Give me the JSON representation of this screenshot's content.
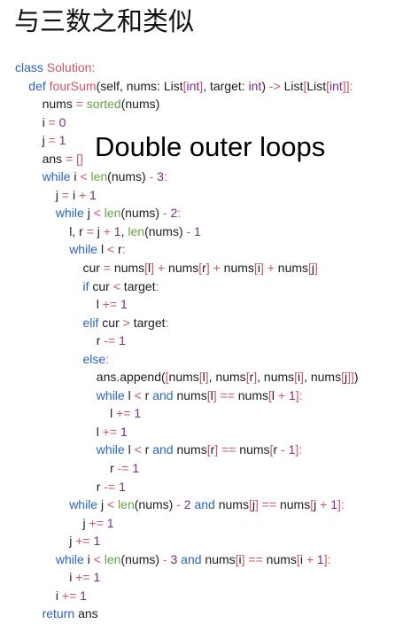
{
  "page": {
    "title": "与三数之和类似",
    "overlay_note": "Double outer loops"
  },
  "colors": {
    "keyword": "#2a64c1",
    "class_name": "#d25564",
    "function_name": "#d25564",
    "builtin": "#66a341",
    "type": "#7c2a8a",
    "number": "#7c2a8a",
    "operator": "#d25564",
    "plain": "#1c1c1c"
  },
  "code": {
    "lines": [
      {
        "indent": 0,
        "tokens": [
          [
            "kw",
            "class "
          ],
          [
            "cls",
            "Solution"
          ],
          [
            "op",
            ":"
          ]
        ]
      },
      {
        "indent": 1,
        "tokens": [
          [
            "kw",
            "def "
          ],
          [
            "fn",
            "fourSum"
          ],
          [
            "pl",
            "(self, nums: List"
          ],
          [
            "op",
            "["
          ],
          [
            "ty",
            "int"
          ],
          [
            "op",
            "]"
          ],
          [
            "pl",
            ", target: "
          ],
          [
            "ty",
            "int"
          ],
          [
            "pl",
            ") "
          ],
          [
            "op",
            "->"
          ],
          [
            "pl",
            " List"
          ],
          [
            "op",
            "["
          ],
          [
            "pl",
            "List"
          ],
          [
            "op",
            "["
          ],
          [
            "ty",
            "int"
          ],
          [
            "op",
            "]]"
          ],
          [
            "op",
            ":"
          ]
        ]
      },
      {
        "indent": 2,
        "tokens": [
          [
            "pl",
            "nums "
          ],
          [
            "op",
            "="
          ],
          [
            "pl",
            " "
          ],
          [
            "bi",
            "sorted"
          ],
          [
            "pl",
            "(nums)"
          ]
        ]
      },
      {
        "indent": 2,
        "tokens": [
          [
            "pl",
            "i "
          ],
          [
            "op",
            "="
          ],
          [
            "pl",
            " "
          ],
          [
            "num",
            "0"
          ]
        ]
      },
      {
        "indent": 2,
        "tokens": [
          [
            "pl",
            "j "
          ],
          [
            "op",
            "="
          ],
          [
            "pl",
            " "
          ],
          [
            "num",
            "1"
          ]
        ]
      },
      {
        "indent": 2,
        "tokens": [
          [
            "pl",
            "ans "
          ],
          [
            "op",
            "="
          ],
          [
            "pl",
            " "
          ],
          [
            "op",
            "[]"
          ]
        ]
      },
      {
        "indent": 2,
        "tokens": [
          [
            "kw",
            "while "
          ],
          [
            "pl",
            "i "
          ],
          [
            "op",
            "<"
          ],
          [
            "pl",
            " "
          ],
          [
            "bi",
            "len"
          ],
          [
            "pl",
            "(nums) "
          ],
          [
            "op",
            "-"
          ],
          [
            "pl",
            " "
          ],
          [
            "num",
            "3"
          ],
          [
            "op",
            ":"
          ]
        ]
      },
      {
        "indent": 3,
        "tokens": [
          [
            "pl",
            "j "
          ],
          [
            "op",
            "="
          ],
          [
            "pl",
            " i "
          ],
          [
            "op",
            "+"
          ],
          [
            "pl",
            " "
          ],
          [
            "num",
            "1"
          ]
        ]
      },
      {
        "indent": 3,
        "tokens": [
          [
            "kw",
            "while "
          ],
          [
            "pl",
            "j "
          ],
          [
            "op",
            "<"
          ],
          [
            "pl",
            " "
          ],
          [
            "bi",
            "len"
          ],
          [
            "pl",
            "(nums) "
          ],
          [
            "op",
            "-"
          ],
          [
            "pl",
            " "
          ],
          [
            "num",
            "2"
          ],
          [
            "op",
            ":"
          ]
        ]
      },
      {
        "indent": 4,
        "tokens": [
          [
            "pl",
            "l, r "
          ],
          [
            "op",
            "="
          ],
          [
            "pl",
            " j "
          ],
          [
            "op",
            "+"
          ],
          [
            "pl",
            " "
          ],
          [
            "num",
            "1"
          ],
          [
            "pl",
            ", "
          ],
          [
            "bi",
            "len"
          ],
          [
            "pl",
            "(nums) "
          ],
          [
            "op",
            "-"
          ],
          [
            "pl",
            " "
          ],
          [
            "num",
            "1"
          ]
        ]
      },
      {
        "indent": 4,
        "tokens": [
          [
            "kw",
            "while "
          ],
          [
            "pl",
            "l "
          ],
          [
            "op",
            "<"
          ],
          [
            "pl",
            " r"
          ],
          [
            "op",
            ":"
          ]
        ]
      },
      {
        "indent": 5,
        "tokens": [
          [
            "pl",
            "cur "
          ],
          [
            "op",
            "="
          ],
          [
            "pl",
            " nums"
          ],
          [
            "op",
            "["
          ],
          [
            "pl",
            "l"
          ],
          [
            "op",
            "]"
          ],
          [
            "pl",
            " "
          ],
          [
            "op",
            "+"
          ],
          [
            "pl",
            " nums"
          ],
          [
            "op",
            "["
          ],
          [
            "pl",
            "r"
          ],
          [
            "op",
            "]"
          ],
          [
            "pl",
            " "
          ],
          [
            "op",
            "+"
          ],
          [
            "pl",
            " nums"
          ],
          [
            "op",
            "["
          ],
          [
            "pl",
            "i"
          ],
          [
            "op",
            "]"
          ],
          [
            "pl",
            " "
          ],
          [
            "op",
            "+"
          ],
          [
            "pl",
            " nums"
          ],
          [
            "op",
            "["
          ],
          [
            "pl",
            "j"
          ],
          [
            "op",
            "]"
          ]
        ]
      },
      {
        "indent": 5,
        "tokens": [
          [
            "kw",
            "if "
          ],
          [
            "pl",
            "cur "
          ],
          [
            "op",
            "<"
          ],
          [
            "pl",
            " target"
          ],
          [
            "op",
            ":"
          ]
        ]
      },
      {
        "indent": 6,
        "tokens": [
          [
            "pl",
            "l "
          ],
          [
            "op",
            "+="
          ],
          [
            "pl",
            " "
          ],
          [
            "num",
            "1"
          ]
        ]
      },
      {
        "indent": 5,
        "tokens": [
          [
            "kw",
            "elif "
          ],
          [
            "pl",
            "cur "
          ],
          [
            "op",
            ">"
          ],
          [
            "pl",
            " target"
          ],
          [
            "op",
            ":"
          ]
        ]
      },
      {
        "indent": 6,
        "tokens": [
          [
            "pl",
            "r "
          ],
          [
            "op",
            "-="
          ],
          [
            "pl",
            " "
          ],
          [
            "num",
            "1"
          ]
        ]
      },
      {
        "indent": 5,
        "tokens": [
          [
            "kw",
            "else"
          ],
          [
            "op",
            ":"
          ]
        ]
      },
      {
        "indent": 6,
        "tokens": [
          [
            "pl",
            "ans.append("
          ],
          [
            "op",
            "["
          ],
          [
            "pl",
            "nums"
          ],
          [
            "op",
            "["
          ],
          [
            "pl",
            "l"
          ],
          [
            "op",
            "]"
          ],
          [
            "pl",
            ", nums"
          ],
          [
            "op",
            "["
          ],
          [
            "pl",
            "r"
          ],
          [
            "op",
            "]"
          ],
          [
            "pl",
            ", nums"
          ],
          [
            "op",
            "["
          ],
          [
            "pl",
            "i"
          ],
          [
            "op",
            "]"
          ],
          [
            "pl",
            ", nums"
          ],
          [
            "op",
            "["
          ],
          [
            "pl",
            "j"
          ],
          [
            "op",
            "]]"
          ],
          [
            "pl",
            ")"
          ]
        ]
      },
      {
        "indent": 6,
        "tokens": [
          [
            "kw",
            "while "
          ],
          [
            "pl",
            "l "
          ],
          [
            "op",
            "<"
          ],
          [
            "pl",
            " r "
          ],
          [
            "kw",
            "and "
          ],
          [
            "pl",
            "nums"
          ],
          [
            "op",
            "["
          ],
          [
            "pl",
            "l"
          ],
          [
            "op",
            "]"
          ],
          [
            "pl",
            " "
          ],
          [
            "op",
            "=="
          ],
          [
            "pl",
            " nums"
          ],
          [
            "op",
            "["
          ],
          [
            "pl",
            "l "
          ],
          [
            "op",
            "+"
          ],
          [
            "pl",
            " "
          ],
          [
            "num",
            "1"
          ],
          [
            "op",
            "]"
          ],
          [
            "op",
            ":"
          ]
        ]
      },
      {
        "indent": 7,
        "tokens": [
          [
            "pl",
            "l "
          ],
          [
            "op",
            "+="
          ],
          [
            "pl",
            " "
          ],
          [
            "num",
            "1"
          ]
        ]
      },
      {
        "indent": 6,
        "tokens": [
          [
            "pl",
            "l "
          ],
          [
            "op",
            "+="
          ],
          [
            "pl",
            " "
          ],
          [
            "num",
            "1"
          ]
        ]
      },
      {
        "indent": 6,
        "tokens": [
          [
            "kw",
            "while "
          ],
          [
            "pl",
            "l "
          ],
          [
            "op",
            "<"
          ],
          [
            "pl",
            " r "
          ],
          [
            "kw",
            "and "
          ],
          [
            "pl",
            "nums"
          ],
          [
            "op",
            "["
          ],
          [
            "pl",
            "r"
          ],
          [
            "op",
            "]"
          ],
          [
            "pl",
            " "
          ],
          [
            "op",
            "=="
          ],
          [
            "pl",
            " nums"
          ],
          [
            "op",
            "["
          ],
          [
            "pl",
            "r "
          ],
          [
            "op",
            "-"
          ],
          [
            "pl",
            " "
          ],
          [
            "num",
            "1"
          ],
          [
            "op",
            "]"
          ],
          [
            "op",
            ":"
          ]
        ]
      },
      {
        "indent": 7,
        "tokens": [
          [
            "pl",
            "r "
          ],
          [
            "op",
            "-="
          ],
          [
            "pl",
            " "
          ],
          [
            "num",
            "1"
          ]
        ]
      },
      {
        "indent": 6,
        "tokens": [
          [
            "pl",
            "r "
          ],
          [
            "op",
            "-="
          ],
          [
            "pl",
            " "
          ],
          [
            "num",
            "1"
          ]
        ]
      },
      {
        "indent": 4,
        "tokens": [
          [
            "kw",
            "while "
          ],
          [
            "pl",
            "j "
          ],
          [
            "op",
            "<"
          ],
          [
            "pl",
            " "
          ],
          [
            "bi",
            "len"
          ],
          [
            "pl",
            "(nums) "
          ],
          [
            "op",
            "-"
          ],
          [
            "pl",
            " "
          ],
          [
            "num",
            "2"
          ],
          [
            "pl",
            " "
          ],
          [
            "kw",
            "and "
          ],
          [
            "pl",
            "nums"
          ],
          [
            "op",
            "["
          ],
          [
            "pl",
            "j"
          ],
          [
            "op",
            "]"
          ],
          [
            "pl",
            " "
          ],
          [
            "op",
            "=="
          ],
          [
            "pl",
            " nums"
          ],
          [
            "op",
            "["
          ],
          [
            "pl",
            "j "
          ],
          [
            "op",
            "+"
          ],
          [
            "pl",
            " "
          ],
          [
            "num",
            "1"
          ],
          [
            "op",
            "]"
          ],
          [
            "op",
            ":"
          ]
        ]
      },
      {
        "indent": 5,
        "tokens": [
          [
            "pl",
            "j "
          ],
          [
            "op",
            "+="
          ],
          [
            "pl",
            " "
          ],
          [
            "num",
            "1"
          ]
        ]
      },
      {
        "indent": 4,
        "tokens": [
          [
            "pl",
            "j "
          ],
          [
            "op",
            "+="
          ],
          [
            "pl",
            " "
          ],
          [
            "num",
            "1"
          ]
        ]
      },
      {
        "indent": 3,
        "tokens": [
          [
            "kw",
            "while "
          ],
          [
            "pl",
            "i "
          ],
          [
            "op",
            "<"
          ],
          [
            "pl",
            " "
          ],
          [
            "bi",
            "len"
          ],
          [
            "pl",
            "(nums) "
          ],
          [
            "op",
            "-"
          ],
          [
            "pl",
            " "
          ],
          [
            "num",
            "3"
          ],
          [
            "pl",
            " "
          ],
          [
            "kw",
            "and "
          ],
          [
            "pl",
            "nums"
          ],
          [
            "op",
            "["
          ],
          [
            "pl",
            "i"
          ],
          [
            "op",
            "]"
          ],
          [
            "pl",
            " "
          ],
          [
            "op",
            "=="
          ],
          [
            "pl",
            " nums"
          ],
          [
            "op",
            "["
          ],
          [
            "pl",
            "i "
          ],
          [
            "op",
            "+"
          ],
          [
            "pl",
            " "
          ],
          [
            "num",
            "1"
          ],
          [
            "op",
            "]"
          ],
          [
            "op",
            ":"
          ]
        ]
      },
      {
        "indent": 4,
        "tokens": [
          [
            "pl",
            "i "
          ],
          [
            "op",
            "+="
          ],
          [
            "pl",
            " "
          ],
          [
            "num",
            "1"
          ]
        ]
      },
      {
        "indent": 3,
        "tokens": [
          [
            "pl",
            "i "
          ],
          [
            "op",
            "+="
          ],
          [
            "pl",
            " "
          ],
          [
            "num",
            "1"
          ]
        ]
      },
      {
        "indent": 2,
        "tokens": [
          [
            "kw",
            "return "
          ],
          [
            "pl",
            "ans"
          ]
        ]
      }
    ]
  }
}
